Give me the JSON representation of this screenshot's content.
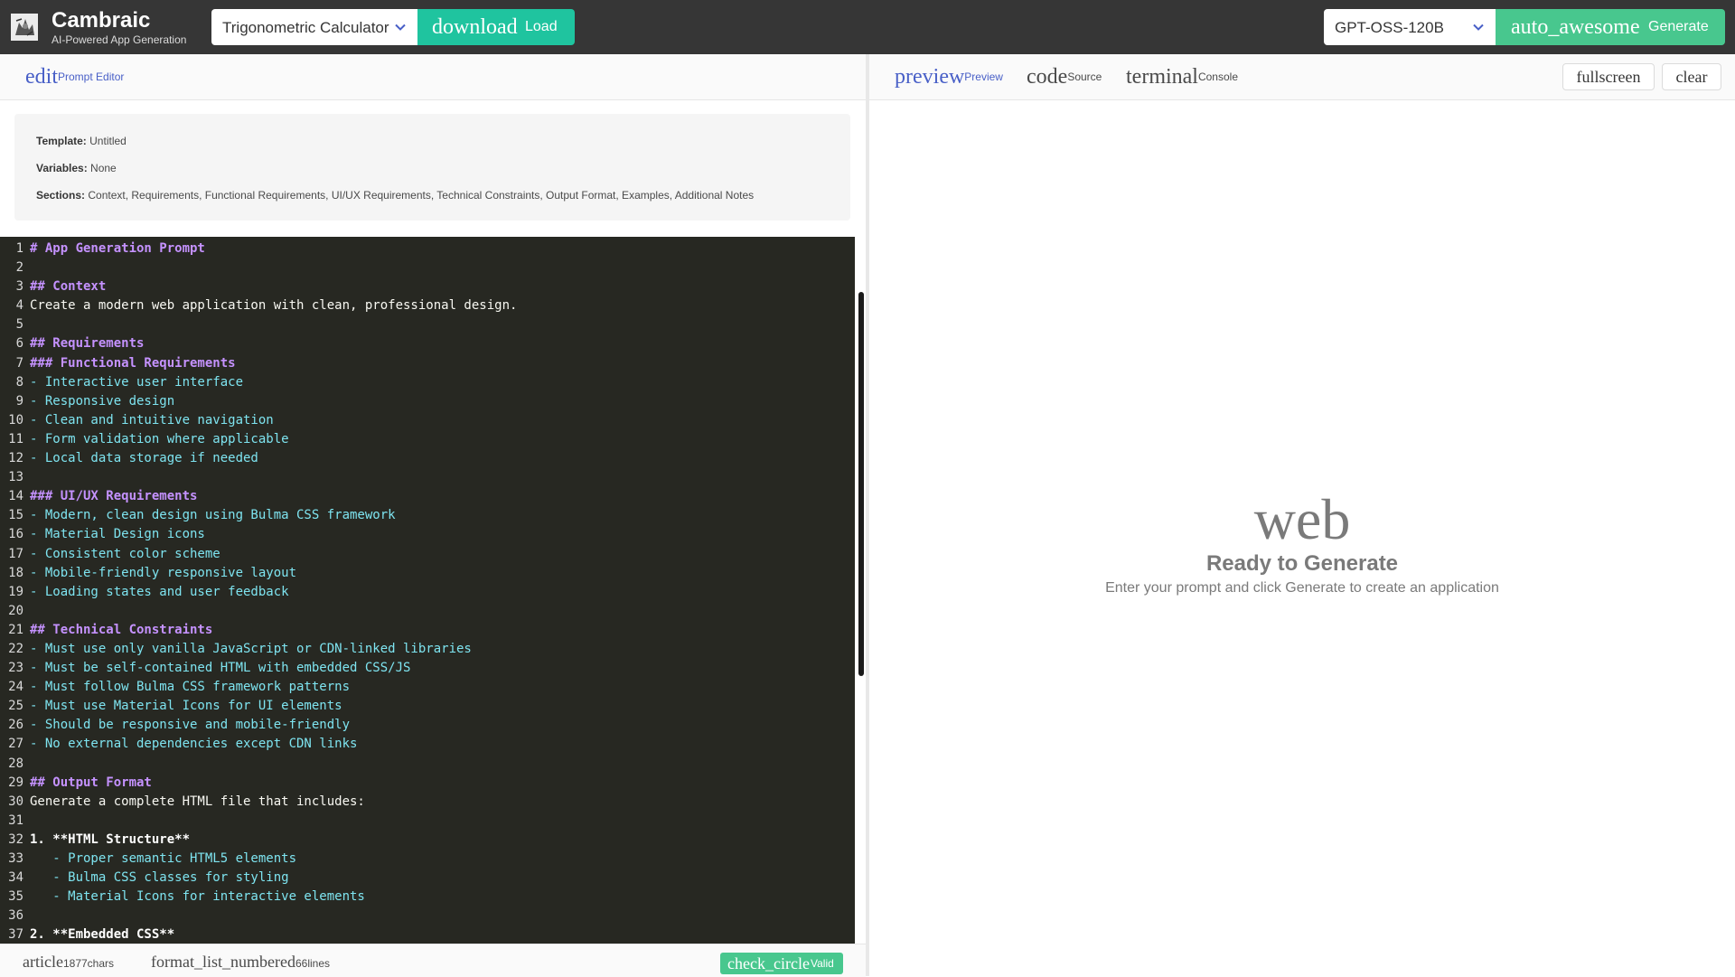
{
  "topbar": {
    "app_title": "Cambraic",
    "app_subtitle": "AI-Powered App Generation",
    "template_select": "Trigonometric Calculator",
    "load_icon": "download",
    "load_label": "Load",
    "model_select": "GPT-OSS-120B",
    "generate_icon": "auto_awesome",
    "generate_label": "Generate"
  },
  "editor": {
    "tab_icon": "edit",
    "tab_label": "Prompt Editor",
    "info": {
      "template_label": "Template:",
      "template_value": "Untitled",
      "variables_label": "Variables:",
      "variables_value": "None",
      "sections_label": "Sections:",
      "sections_value": "Context, Requirements, Functional Requirements, UI/UX Requirements, Technical Constraints, Output Format, Examples, Additional Notes"
    },
    "lines": [
      {
        "n": "1",
        "t": "# App Generation Prompt",
        "k": "h"
      },
      {
        "n": "2",
        "t": "",
        "k": "p"
      },
      {
        "n": "3",
        "t": "## Context",
        "k": "h"
      },
      {
        "n": "4",
        "t": "Create a modern web application with clean, professional design.",
        "k": "p"
      },
      {
        "n": "5",
        "t": "",
        "k": "p"
      },
      {
        "n": "6",
        "t": "## Requirements",
        "k": "h"
      },
      {
        "n": "7",
        "t": "### Functional Requirements",
        "k": "h"
      },
      {
        "n": "8",
        "t": "- Interactive user interface",
        "k": "l"
      },
      {
        "n": "9",
        "t": "- Responsive design",
        "k": "l"
      },
      {
        "n": "10",
        "t": "- Clean and intuitive navigation",
        "k": "l"
      },
      {
        "n": "11",
        "t": "- Form validation where applicable",
        "k": "l"
      },
      {
        "n": "12",
        "t": "- Local data storage if needed",
        "k": "l"
      },
      {
        "n": "13",
        "t": "",
        "k": "p"
      },
      {
        "n": "14",
        "t": "### UI/UX Requirements",
        "k": "h"
      },
      {
        "n": "15",
        "t": "- Modern, clean design using Bulma CSS framework",
        "k": "l"
      },
      {
        "n": "16",
        "t": "- Material Design icons",
        "k": "l"
      },
      {
        "n": "17",
        "t": "- Consistent color scheme",
        "k": "l"
      },
      {
        "n": "18",
        "t": "- Mobile-friendly responsive layout",
        "k": "l"
      },
      {
        "n": "19",
        "t": "- Loading states and user feedback",
        "k": "l"
      },
      {
        "n": "20",
        "t": "",
        "k": "p"
      },
      {
        "n": "21",
        "t": "## Technical Constraints",
        "k": "h"
      },
      {
        "n": "22",
        "t": "- Must use only vanilla JavaScript or CDN-linked libraries",
        "k": "l"
      },
      {
        "n": "23",
        "t": "- Must be self-contained HTML with embedded CSS/JS",
        "k": "l"
      },
      {
        "n": "24",
        "t": "- Must follow Bulma CSS framework patterns",
        "k": "l"
      },
      {
        "n": "25",
        "t": "- Must use Material Icons for UI elements",
        "k": "l"
      },
      {
        "n": "26",
        "t": "- Should be responsive and mobile-friendly",
        "k": "l"
      },
      {
        "n": "27",
        "t": "- No external dependencies except CDN links",
        "k": "l"
      },
      {
        "n": "28",
        "t": "",
        "k": "p"
      },
      {
        "n": "29",
        "t": "## Output Format",
        "k": "h"
      },
      {
        "n": "30",
        "t": "Generate a complete HTML file that includes:",
        "k": "p"
      },
      {
        "n": "31",
        "t": "",
        "k": "p"
      },
      {
        "n": "32",
        "t": "1. **HTML Structure**",
        "k": "b"
      },
      {
        "n": "33",
        "t": "   - Proper semantic HTML5 elements",
        "k": "l"
      },
      {
        "n": "34",
        "t": "   - Bulma CSS classes for styling",
        "k": "l"
      },
      {
        "n": "35",
        "t": "   - Material Icons for interactive elements",
        "k": "l"
      },
      {
        "n": "36",
        "t": "",
        "k": "p"
      },
      {
        "n": "37",
        "t": "2. **Embedded CSS**",
        "k": "b"
      }
    ],
    "status": {
      "chars_icon": "article",
      "chars_value": "1877",
      "chars_label": "chars",
      "lines_icon": "format_list_numbered",
      "lines_value": "66",
      "lines_label": "lines",
      "valid_icon": "check_circle",
      "valid_label": "Valid"
    }
  },
  "preview": {
    "tabs": [
      {
        "icon": "preview",
        "label": "Preview"
      },
      {
        "icon": "code",
        "label": "Source"
      },
      {
        "icon": "terminal",
        "label": "Console"
      }
    ],
    "fullscreen_label": "fullscreen",
    "clear_label": "clear",
    "empty_icon": "web",
    "empty_title": "Ready to Generate",
    "empty_text": "Enter your prompt and click Generate to create an application"
  },
  "colors": {
    "topbar_bg": "#363636",
    "accent_primary": "#485fc7",
    "load_button": "#1fc49f",
    "success": "#48c78e",
    "editor_bg": "#272822",
    "heading_purple": "#c592ff",
    "list_cyan": "#7ee4f0"
  }
}
